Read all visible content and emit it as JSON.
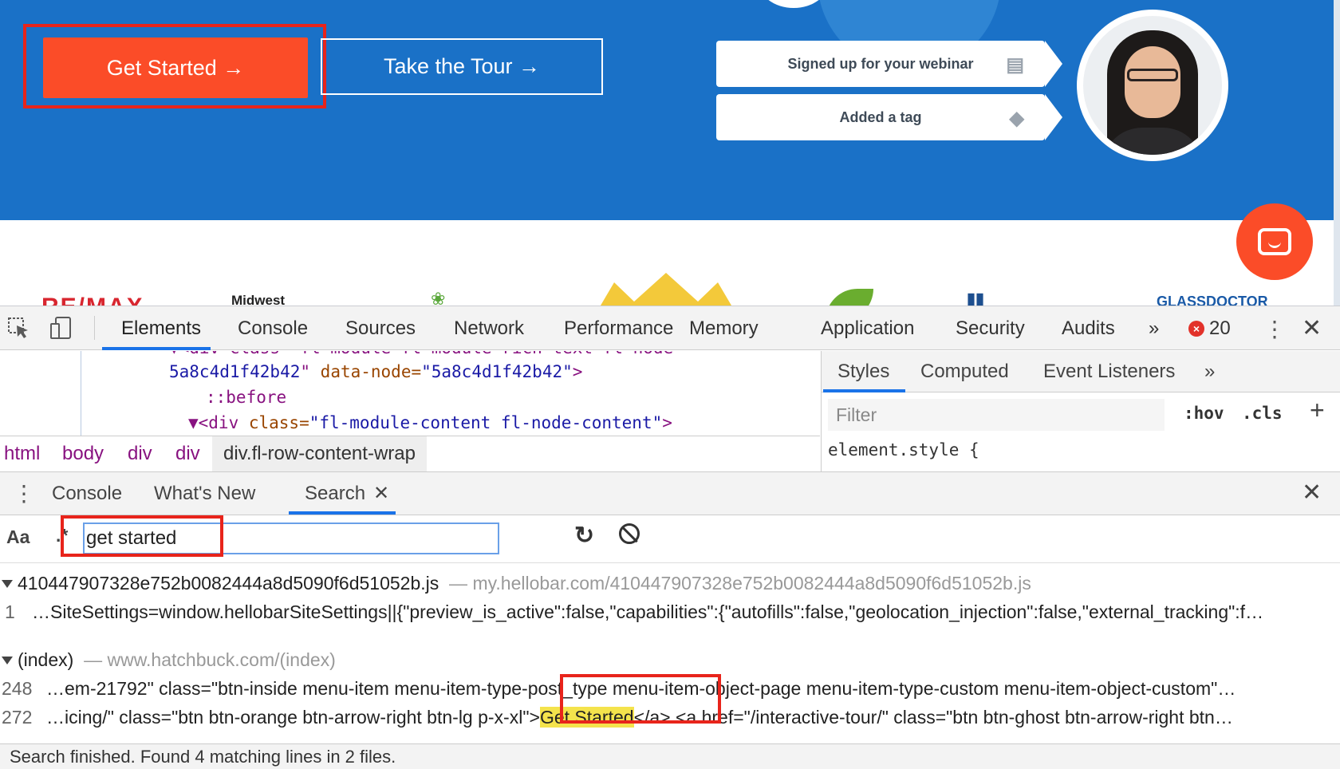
{
  "website": {
    "get_started_label": "Get Started →",
    "tour_label": "Take the Tour →",
    "notifications": [
      {
        "text": "Signed up for your webinar",
        "icon": "webinar-screen-icon"
      },
      {
        "text": "Added a tag",
        "icon": "tag-icon"
      }
    ],
    "logos": {
      "remax": "RE/MAX",
      "midwest": "Midwest",
      "glass": "GLASSDOCTOR"
    },
    "colors": {
      "hero": "#1a71c7",
      "accent": "#fb4c28"
    }
  },
  "devtools": {
    "tabs": [
      "Elements",
      "Console",
      "Sources",
      "Network",
      "Performance",
      "Memory",
      "Application",
      "Security",
      "Audits"
    ],
    "more_tabs": "»",
    "error_count": "20",
    "dom": {
      "line0": "▼<div class=\"fl-module fl-module-rich-text fl-node",
      "line1_val": "5a8c4d1f42b42",
      "line1_attr": " data-node=",
      "line1_val2": "\"5a8c4d1f42b42\"",
      "line2": "::before",
      "line3_tag": "▼<div ",
      "line3_attr": "class=",
      "line3_val": "\"fl-module-content fl-node-content\"",
      "line3_end": ">"
    },
    "breadcrumbs": [
      "html",
      "body",
      "div",
      "div",
      "div.fl-row-content-wrap"
    ],
    "styles_tabs": [
      "Styles",
      "Computed",
      "Event Listeners"
    ],
    "styles_more": "»",
    "filter_placeholder": "Filter",
    "hov": ":hov",
    "cls": ".cls",
    "element_style": "element.style {",
    "drawer_tabs": [
      "Console",
      "What's New",
      "Search"
    ],
    "search": {
      "case_label": "Aa",
      "regex_label": ".*",
      "query": "get started"
    },
    "results": [
      {
        "file": "410447907328e752b0082444a8d5090f6d51052b.js",
        "url": "my.hellobar.com/410447907328e752b0082444a8d5090f6d51052b.js",
        "lines": [
          {
            "num": "1",
            "text": "…SiteSettings=window.hellobarSiteSettings||{\"preview_is_active\":false,\"capabilities\":{\"autofills\":false,\"geolocation_injection\":false,\"external_tracking\":f…"
          }
        ]
      },
      {
        "file": "(index)",
        "url": "www.hatchbuck.com/(index)",
        "lines": [
          {
            "num": "248",
            "text": "…em-21792\" class=\"btn-inside menu-item menu-item-type-post_type menu-item-object-page menu-item-type-custom menu-item-object-custom\"…"
          },
          {
            "num": "272",
            "pre": "…icing/\" class=\"btn btn-orange btn-arrow-right btn-lg p-x-xl\">",
            "match": "Get Started",
            "post": "</a>  <a href=\"/interactive-tour/\" class=\"btn btn-ghost btn-arrow-right btn…"
          }
        ]
      }
    ],
    "status": "Search finished.  Found 4 matching lines in 2 files."
  }
}
